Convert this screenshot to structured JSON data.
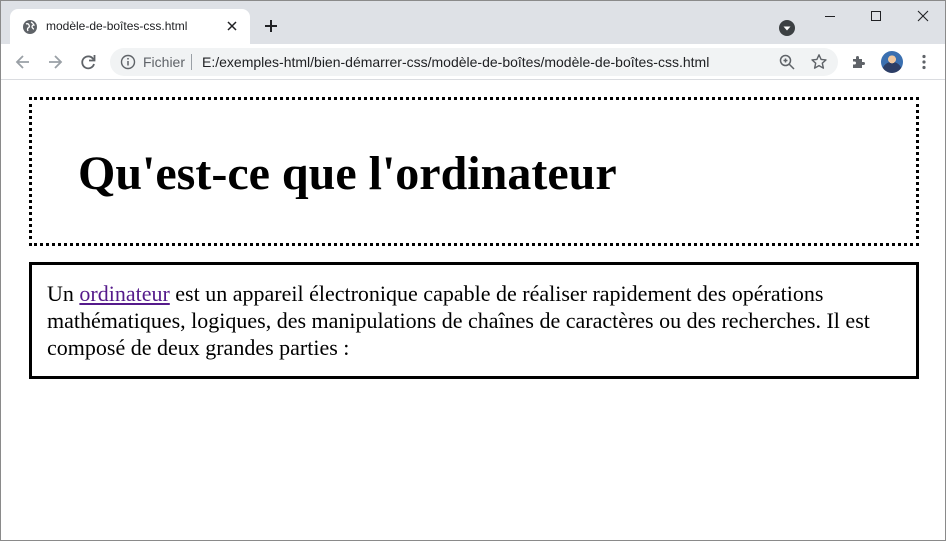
{
  "browser": {
    "tab": {
      "title": "modèle-de-boîtes-css.html",
      "favicon": "globe-icon"
    },
    "new_tab_icon": "plus-icon",
    "address_bar": {
      "scheme_label": "Fichier",
      "url": "E:/exemples-html/bien-démarrer-css/modèle-de-boîtes/modèle-de-boîtes-css.html"
    }
  },
  "page": {
    "heading": "Qu'est-ce que l'ordinateur",
    "paragraph": {
      "before_link": "Un ",
      "link_text": "ordinateur",
      "after_link": " est un appareil électronique capable de réaliser rapidement des opérations mathématiques, logiques, des manipulations de chaînes de caractères ou des recherches. Il est composé de deux grandes parties :"
    }
  },
  "colors": {
    "tabstrip_bg": "#dee1e6",
    "omnibox_bg": "#f1f3f4",
    "visited_link": "#551a8b"
  }
}
